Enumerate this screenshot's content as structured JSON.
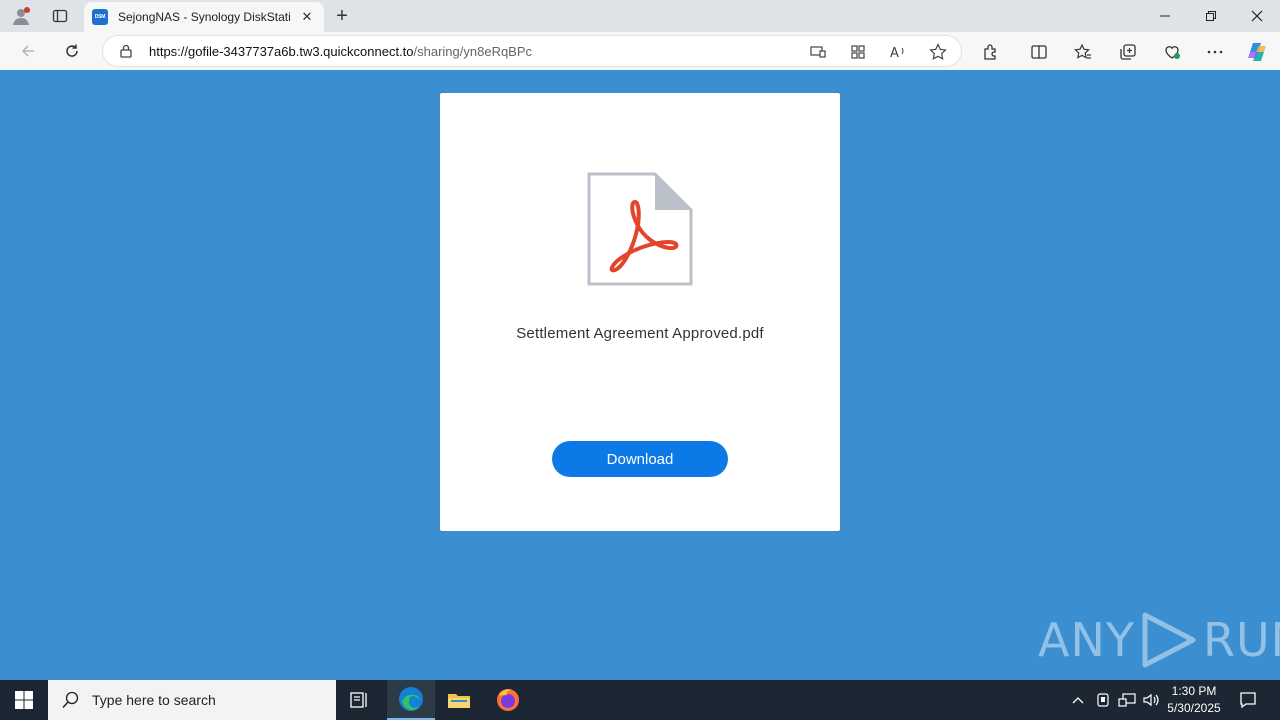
{
  "browser": {
    "tab_title": "SejongNAS - Synology DiskStation",
    "tab_favicon_text": "DSM",
    "new_tab_label": "+",
    "url_host": "https://gofile-3437737a6b.tw3.quickconnect.to",
    "url_path": "/sharing/yn8eRqBPc"
  },
  "page": {
    "file_name": "Settlement Agreement Approved.pdf",
    "download_label": "Download",
    "background_color": "#3b8ed0",
    "button_color": "#0b7ae6"
  },
  "watermark": {
    "left": "ANY",
    "right": "RUN"
  },
  "taskbar": {
    "search_placeholder": "Type here to search",
    "time": "1:30 PM",
    "date": "5/30/2025"
  }
}
